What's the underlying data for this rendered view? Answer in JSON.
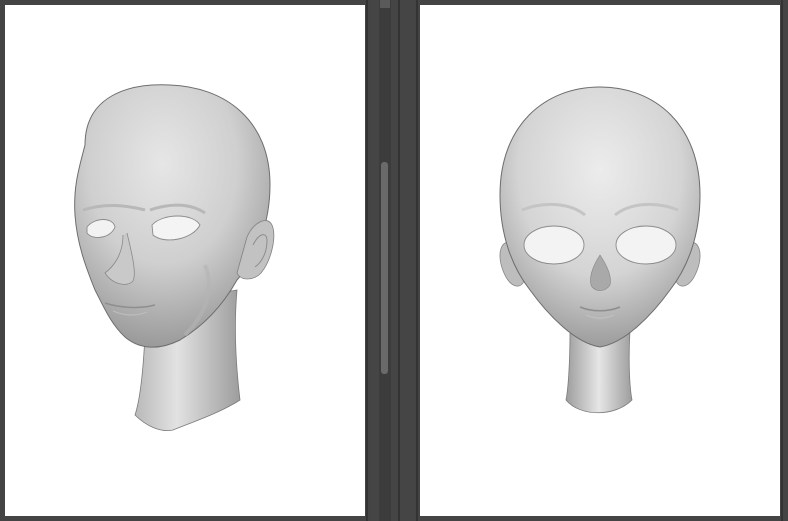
{
  "window": {
    "background_color": "#444444",
    "canvas_color": "#ffffff"
  },
  "viewports": [
    {
      "id": "left",
      "subject": "3d-head-model",
      "view": "three-quarter"
    },
    {
      "id": "right",
      "subject": "3d-head-model",
      "view": "front"
    }
  ],
  "scrollbar": {
    "orientation": "vertical"
  }
}
